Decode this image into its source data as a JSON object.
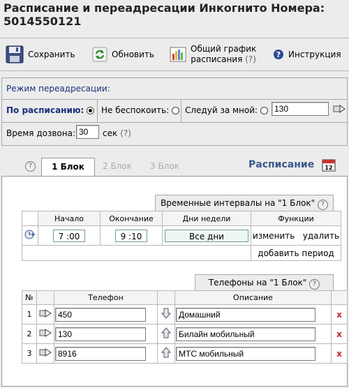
{
  "page": {
    "title": "Расписание и переадресации Инкогнито Номера: 5014550121"
  },
  "toolbar": {
    "save_label": "Сохранить",
    "refresh_label": "Обновить",
    "schedule_label_1": "Общий график",
    "schedule_label_2": "расписания",
    "help_q": "(?)",
    "instructions_label": "Инструкция"
  },
  "forwarding": {
    "mode_title": "Режим переадресации:",
    "by_schedule": "По расписанию:",
    "do_not_disturb": "Не беспокоить:",
    "follow_me": "Следуй за мной:",
    "follow_me_number": "130",
    "dial_time_label": "Время дозвона:",
    "dial_time_value": "30",
    "seconds_label": "сек",
    "help_q": "(?)",
    "selected_mode": "by_schedule"
  },
  "tabs": {
    "items": [
      {
        "label": "1 Блок",
        "active": true
      },
      {
        "label": "2 Блок",
        "active": false
      },
      {
        "label": "3 Блок",
        "active": false
      }
    ],
    "schedule_title": "Расписание"
  },
  "intervals": {
    "caption": "Временные интервалы на \"1 Блок\"",
    "headers": {
      "start": "Начало",
      "end": "Окончание",
      "days": "Дни недели",
      "functions": "Функции"
    },
    "rows": [
      {
        "start": "7 :00",
        "end": "9 :10",
        "days": "Все дни",
        "edit": "изменить",
        "delete": "удалить"
      }
    ],
    "add_period": "добавить период"
  },
  "phones": {
    "caption": "Телефоны на \"1 Блок\"",
    "headers": {
      "num": "№",
      "phone": "Телефон",
      "description": "Описание"
    },
    "rows": [
      {
        "num": "1",
        "phone": "450",
        "description": "Домашний",
        "delete": "x"
      },
      {
        "num": "2",
        "phone": "130",
        "description": "Билайн мобильный",
        "delete": "x"
      },
      {
        "num": "3",
        "phone": "8916",
        "description": "МТС мобильный",
        "delete": "x"
      }
    ]
  },
  "colors": {
    "accent": "#1a2f7a",
    "danger": "#cc2222",
    "panel": "#ececec"
  }
}
